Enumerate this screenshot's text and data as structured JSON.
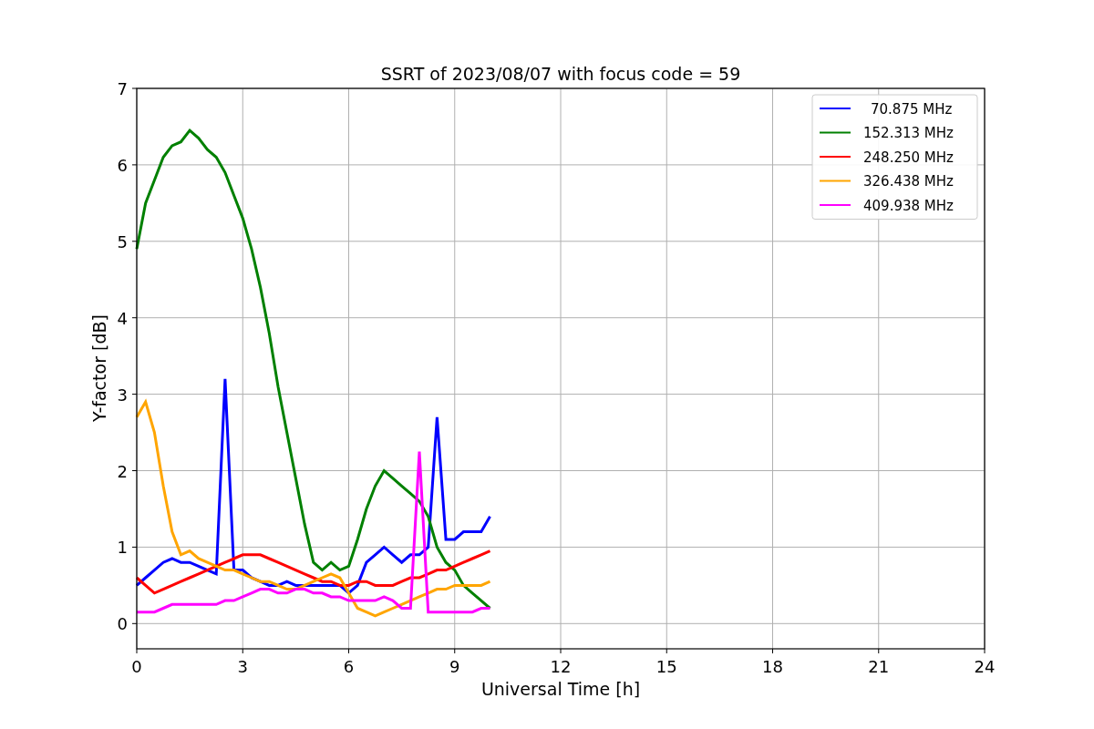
{
  "chart_data": {
    "type": "line",
    "title": "SSRT of 2023/08/07 with focus code = 59",
    "xlabel": "Universal Time [h]",
    "ylabel": "Y-factor [dB]",
    "x": [
      0,
      0.25,
      0.5,
      0.75,
      1,
      1.25,
      1.5,
      1.75,
      2,
      2.25,
      2.5,
      2.75,
      3,
      3.25,
      3.5,
      3.75,
      4,
      4.25,
      4.5,
      4.75,
      5,
      5.25,
      5.5,
      5.75,
      6,
      6.25,
      6.5,
      6.75,
      7,
      7.25,
      7.5,
      7.75,
      8,
      8.25,
      8.5,
      8.75,
      9,
      9.25,
      9.5,
      9.75,
      10
    ],
    "series": [
      {
        "name": "70.875 MHz",
        "color": "#0000ff",
        "values": [
          0.5,
          0.6,
          0.7,
          0.8,
          0.85,
          0.8,
          0.8,
          0.75,
          0.7,
          0.65,
          3.2,
          0.7,
          0.7,
          0.6,
          0.55,
          0.5,
          0.5,
          0.55,
          0.5,
          0.5,
          0.5,
          0.5,
          0.5,
          0.5,
          0.4,
          0.5,
          0.8,
          0.9,
          1.0,
          0.9,
          0.8,
          0.9,
          0.9,
          1.0,
          2.7,
          1.1,
          1.1,
          1.2,
          1.2,
          1.2,
          1.4
        ]
      },
      {
        "name": "152.313 MHz",
        "color": "#008000",
        "values": [
          4.9,
          5.5,
          5.8,
          6.1,
          6.25,
          6.3,
          6.45,
          6.35,
          6.2,
          6.1,
          5.9,
          5.6,
          5.3,
          4.9,
          4.4,
          3.8,
          3.1,
          2.5,
          1.9,
          1.3,
          0.8,
          0.7,
          0.8,
          0.7,
          0.75,
          1.1,
          1.5,
          1.8,
          2.0,
          1.9,
          1.8,
          1.7,
          1.6,
          1.4,
          1.0,
          0.8,
          0.7,
          0.5,
          0.4,
          0.3,
          0.2
        ]
      },
      {
        "name": "248.250 MHz",
        "color": "#ff0000",
        "values": [
          0.6,
          0.5,
          0.4,
          0.45,
          0.5,
          0.55,
          0.6,
          0.65,
          0.7,
          0.75,
          0.8,
          0.85,
          0.9,
          0.9,
          0.9,
          0.85,
          0.8,
          0.75,
          0.7,
          0.65,
          0.6,
          0.55,
          0.55,
          0.5,
          0.5,
          0.55,
          0.55,
          0.5,
          0.5,
          0.5,
          0.55,
          0.6,
          0.6,
          0.65,
          0.7,
          0.7,
          0.75,
          0.8,
          0.85,
          0.9,
          0.95
        ]
      },
      {
        "name": "326.438 MHz",
        "color": "#ffa500",
        "values": [
          2.7,
          2.9,
          2.5,
          1.8,
          1.2,
          0.9,
          0.95,
          0.85,
          0.8,
          0.75,
          0.7,
          0.7,
          0.65,
          0.6,
          0.55,
          0.55,
          0.5,
          0.45,
          0.45,
          0.5,
          0.55,
          0.6,
          0.65,
          0.6,
          0.4,
          0.2,
          0.15,
          0.1,
          0.15,
          0.2,
          0.25,
          0.3,
          0.35,
          0.4,
          0.45,
          0.45,
          0.5,
          0.5,
          0.5,
          0.5,
          0.55
        ]
      },
      {
        "name": "409.938 MHz",
        "color": "#ff00ff",
        "values": [
          0.15,
          0.15,
          0.15,
          0.2,
          0.25,
          0.25,
          0.25,
          0.25,
          0.25,
          0.25,
          0.3,
          0.3,
          0.35,
          0.4,
          0.45,
          0.45,
          0.4,
          0.4,
          0.45,
          0.45,
          0.4,
          0.4,
          0.35,
          0.35,
          0.3,
          0.3,
          0.3,
          0.3,
          0.35,
          0.3,
          0.2,
          0.2,
          2.25,
          0.15,
          0.15,
          0.15,
          0.15,
          0.15,
          0.15,
          0.2,
          0.2
        ]
      }
    ],
    "grid": true,
    "legend": true,
    "xlim": [
      0,
      24
    ],
    "ylim": [
      -0.33,
      7
    ],
    "xticks": [
      0,
      3,
      6,
      9,
      12,
      15,
      18,
      21,
      24
    ],
    "yticks": [
      0,
      1,
      2,
      3,
      4,
      5,
      6,
      7
    ]
  }
}
